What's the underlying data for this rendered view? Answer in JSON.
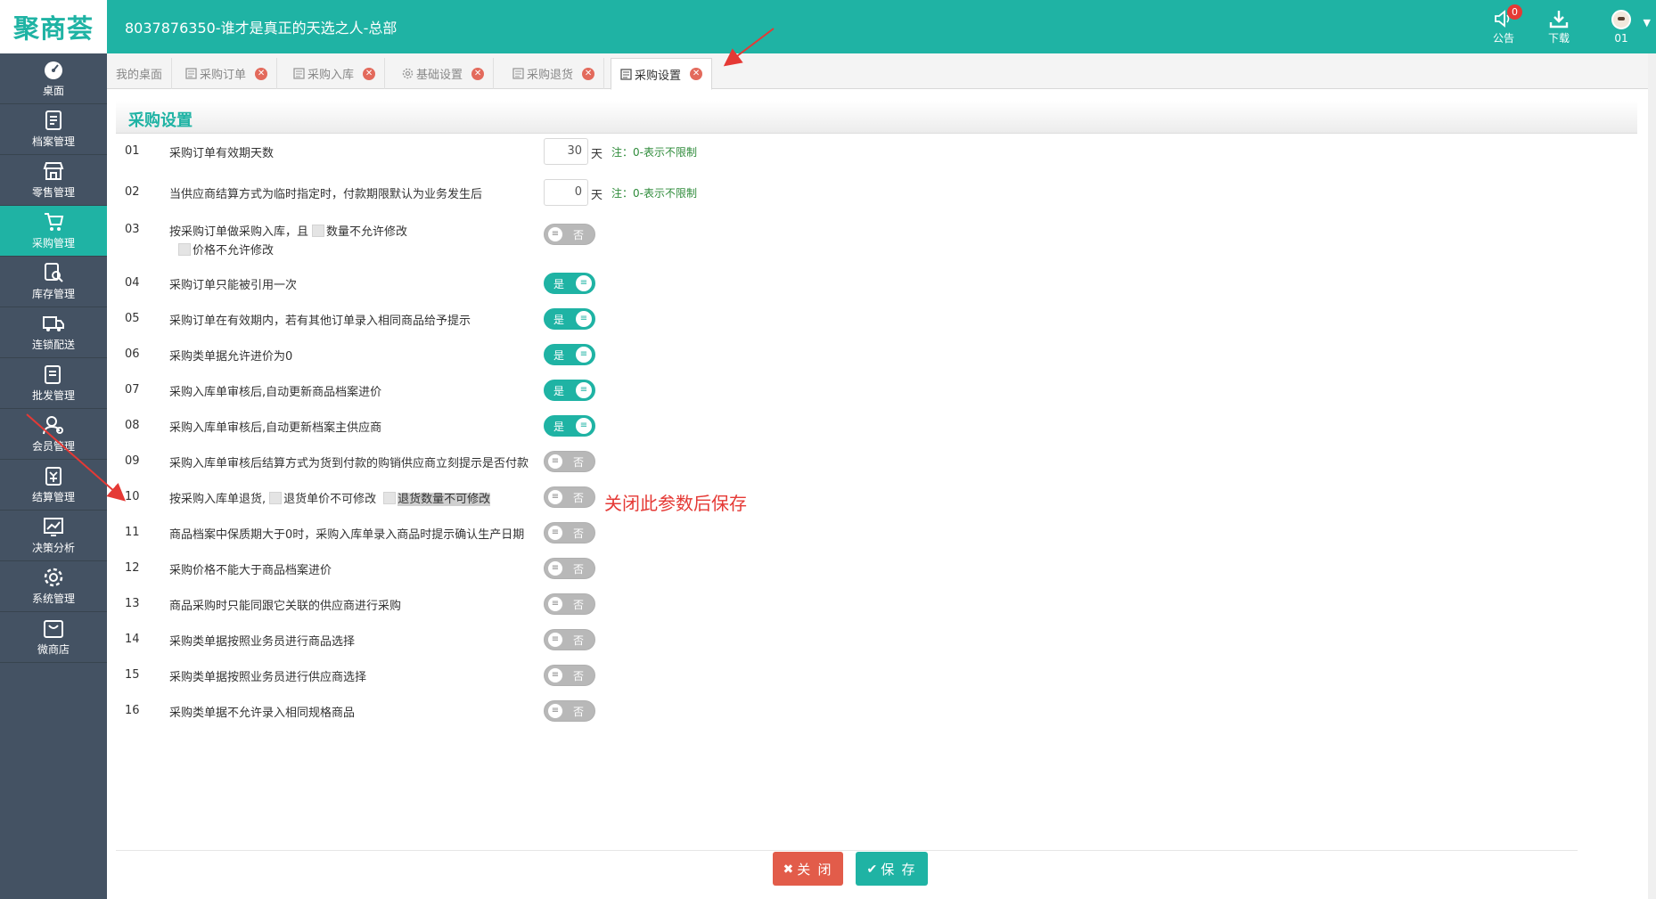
{
  "colors": {
    "brand": "#1fb3a4",
    "sidebar": "#445263",
    "danger": "#e25c4a",
    "note": "#2e8b3a",
    "annotation": "#e53935"
  },
  "header": {
    "logo": "聚商荟",
    "title": "8037876350-谁才是真正的天选之人-总部",
    "notice_label": "公告",
    "notice_count": "0",
    "download_label": "下载",
    "user_label": "01"
  },
  "sidebar": {
    "items": [
      {
        "label": "桌面",
        "icon": "dashboard-icon"
      },
      {
        "label": "档案管理",
        "icon": "archive-icon"
      },
      {
        "label": "零售管理",
        "icon": "store-icon"
      },
      {
        "label": "采购管理",
        "icon": "cart-icon",
        "active": true
      },
      {
        "label": "库存管理",
        "icon": "inventory-icon"
      },
      {
        "label": "连锁配送",
        "icon": "truck-icon"
      },
      {
        "label": "批发管理",
        "icon": "wholesale-icon"
      },
      {
        "label": "会员管理",
        "icon": "member-icon"
      },
      {
        "label": "结算管理",
        "icon": "settlement-icon"
      },
      {
        "label": "决策分析",
        "icon": "chart-icon"
      },
      {
        "label": "系统管理",
        "icon": "gear-icon"
      },
      {
        "label": "微商店",
        "icon": "shop-bag-icon"
      }
    ]
  },
  "tabs": [
    {
      "label": "我的桌面"
    },
    {
      "label": "采购订单"
    },
    {
      "label": "采购入库"
    },
    {
      "label": "基础设置"
    },
    {
      "label": "采购退货"
    },
    {
      "label": "采购设置",
      "active": true
    }
  ],
  "page": {
    "title": "采购设置"
  },
  "settings": {
    "r1": {
      "no": "01",
      "label": "采购订单有效期天数",
      "value": "30",
      "unit": "天",
      "note": "注：0-表示不限制"
    },
    "r2": {
      "no": "02",
      "label": "当供应商结算方式为临时指定时，付款期限默认为业务发生后",
      "value": "0",
      "unit": "天",
      "note": "注：0-表示不限制"
    },
    "r3": {
      "no": "03",
      "label_a": "按采购订单做采购入库，且",
      "label_b": "数量不允许修改",
      "label_c": "价格不允许修改",
      "state": "否"
    },
    "r4": {
      "no": "04",
      "label": "采购订单只能被引用一次",
      "state": "是"
    },
    "r5": {
      "no": "05",
      "label": "采购订单在有效期内，若有其他订单录入相同商品给予提示",
      "state": "是"
    },
    "r6": {
      "no": "06",
      "label": "采购类单据允许进价为0",
      "state": "是"
    },
    "r7": {
      "no": "07",
      "label": "采购入库单审核后,自动更新商品档案进价",
      "state": "是"
    },
    "r8": {
      "no": "08",
      "label": "采购入库单审核后,自动更新档案主供应商",
      "state": "是"
    },
    "r9": {
      "no": "09",
      "label": "采购入库单审核后结算方式为货到付款的购销供应商立刻提示是否付款",
      "state": "否"
    },
    "r10": {
      "no": "10",
      "label_a": "按采购入库单退货,",
      "label_b": "退货单价不可修改",
      "label_c": "退货数量不可修改",
      "state": "否"
    },
    "r11": {
      "no": "11",
      "label": "商品档案中保质期大于0时，采购入库单录入商品时提示确认生产日期",
      "state": "否"
    },
    "r12": {
      "no": "12",
      "label": "采购价格不能大于商品档案进价",
      "state": "否"
    },
    "r13": {
      "no": "13",
      "label": "商品采购时只能同跟它关联的供应商进行采购",
      "state": "否"
    },
    "r14": {
      "no": "14",
      "label": "采购类单据按照业务员进行商品选择",
      "state": "否"
    },
    "r15": {
      "no": "15",
      "label": "采购类单据按照业务员进行供应商选择",
      "state": "否"
    },
    "r16": {
      "no": "16",
      "label": "采购类单据不允许录入相同规格商品",
      "state": "否"
    }
  },
  "annotation": {
    "text": "关闭此参数后保存"
  },
  "footer": {
    "close_label": "关 闭",
    "save_label": "保 存"
  }
}
